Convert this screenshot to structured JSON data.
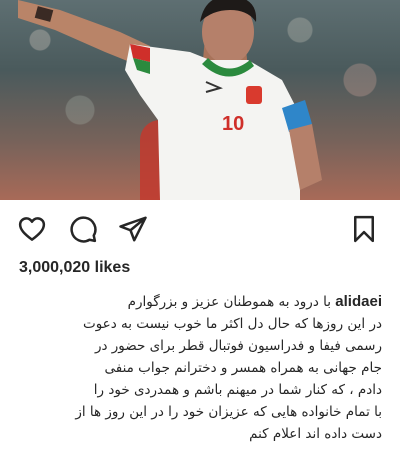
{
  "post": {
    "likes": "3,000,020 likes",
    "username": "alidaei",
    "caption_first": "با درود به هموطنان عزیز و بزرگوارم",
    "caption_lines": [
      "در این روزها که حال دل اکثر ما خوب نیست به دعوت",
      "رسمی فیفا و فدراسیون فوتبال قطر برای حضور در",
      "جام جهانی به همراه همسر و دخترانم جواب منفی",
      "دادم ، که کنار شما در میهنم باشم و همدردی خود را",
      "با تمام خانواده هایی که عزیزان خود را در این روز ها از",
      "دست داده اند اعلام کنم"
    ],
    "jersey_number": "10"
  },
  "icons": {
    "like": "heart-icon",
    "comment": "comment-icon",
    "share": "share-icon",
    "save": "bookmark-icon"
  },
  "colors": {
    "text": "#262626",
    "background": "#ffffff"
  }
}
